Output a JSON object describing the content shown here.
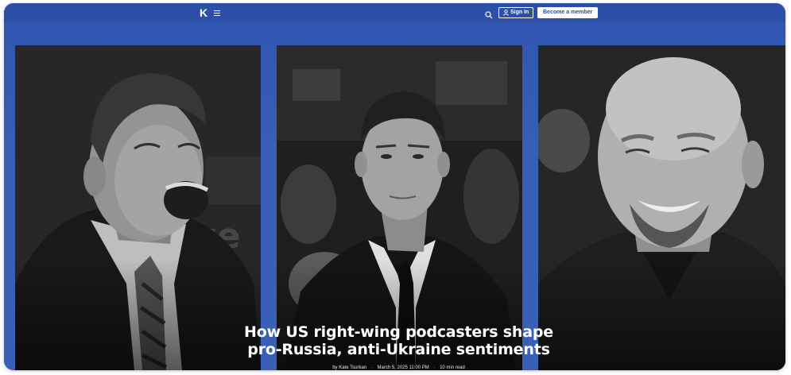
{
  "header": {
    "logo_text": "K",
    "menu_icon": "hamburger-menu-icon",
    "search_icon": "search-icon",
    "signin_label": "Sign In",
    "member_label": "Become a member",
    "accent_color": "#2d4fa8"
  },
  "article": {
    "headline_line1": "How US right-wing podcasters shape",
    "headline_line2": "pro-Russia, anti-Ukraine sentiments",
    "byline": "by Kate Tsurkan",
    "date": "March 5, 2025 11:00 PM",
    "read_time": "10 min read"
  },
  "photos": {
    "left_text": "ze"
  }
}
